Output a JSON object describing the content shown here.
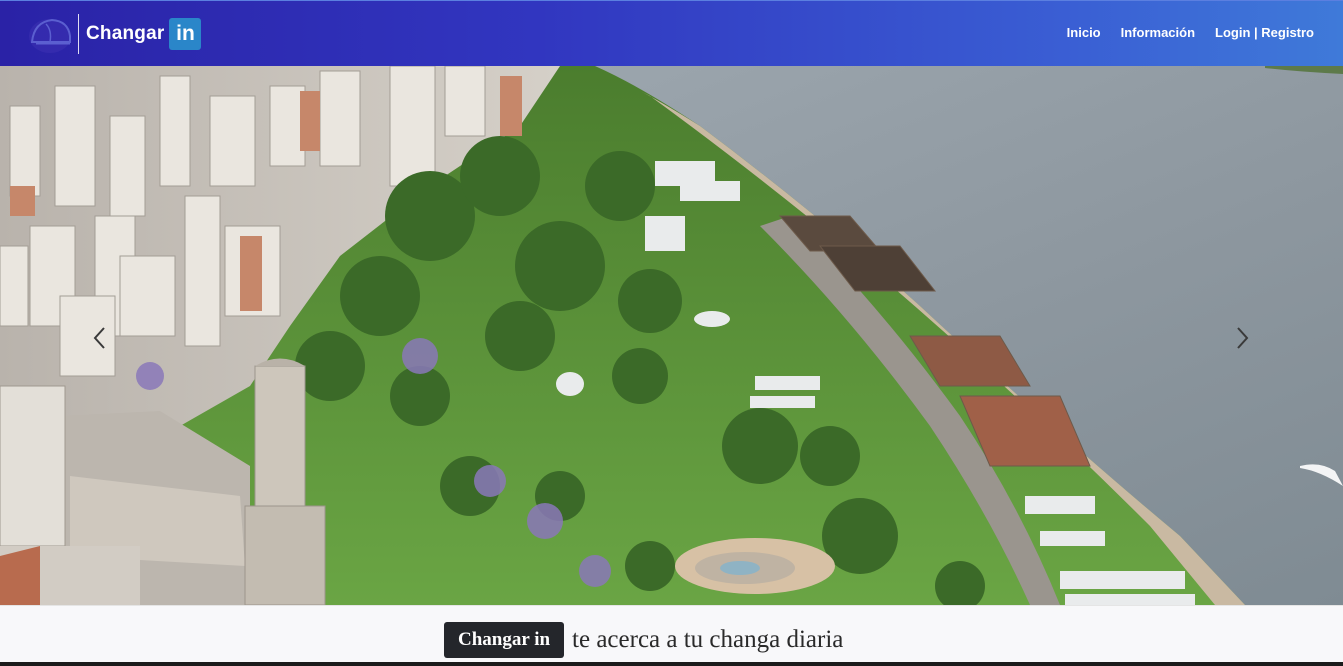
{
  "navbar": {
    "brand_name": "Changar",
    "brand_badge": "in",
    "links": [
      {
        "label": "Inicio"
      },
      {
        "label": "Información"
      },
      {
        "label": "Login | Registro"
      }
    ]
  },
  "hero": {
    "image_icon": "aerial-city-river-photo",
    "prev_icon": "chevron-left-icon",
    "next_icon": "chevron-right-icon"
  },
  "tagline": {
    "badge": "Changar in",
    "text": "te acerca a tu changa diaria"
  },
  "colors": {
    "nav_start": "#2a22a6",
    "nav_end": "#3f7ad9",
    "badge_blue": "#2a86c9",
    "tagline_badge": "#24262b",
    "river": "#8f9aa3",
    "park": "#5f9a3c"
  }
}
